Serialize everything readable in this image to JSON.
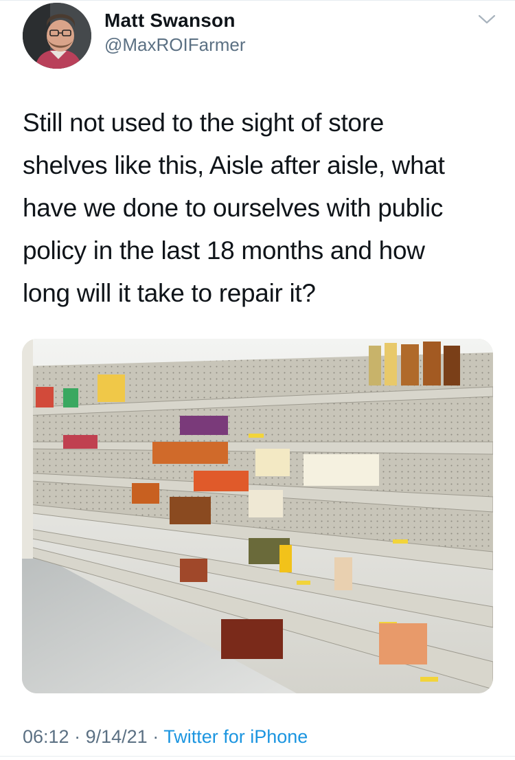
{
  "author": {
    "name": "Matt Swanson",
    "handle": "@MaxROIFarmer"
  },
  "tweet": {
    "text_lines": [
      "Still not used to the sight of store",
      "shelves like this, Aisle after aisle, what",
      "have we done to ourselves with public",
      "policy in the last 18 months and how",
      "long will it take to repair it?"
    ]
  },
  "meta": {
    "time": "06:12",
    "separator": "·",
    "date": "9/14/21",
    "source": "Twitter for iPhone"
  },
  "colors": {
    "secondary_text": "#5b7083",
    "link": "#1b95e0"
  },
  "icons": {
    "menu": "chevron-down-icon"
  }
}
